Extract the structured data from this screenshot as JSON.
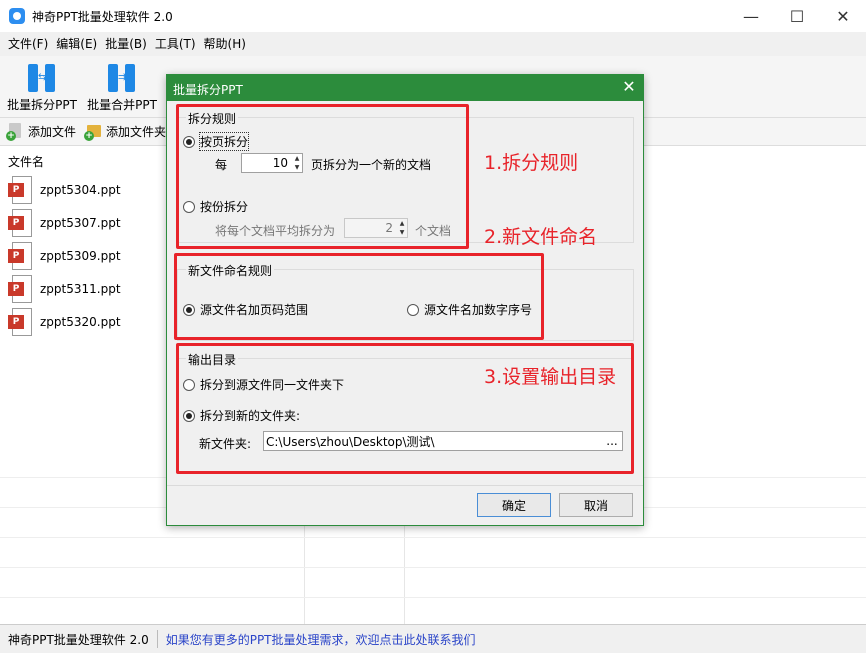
{
  "window": {
    "title": "神奇PPT批量处理软件 2.0",
    "min": "—",
    "max": "☐",
    "close": "✕"
  },
  "menu": [
    "文件(F)",
    "编辑(E)",
    "批量(B)",
    "工具(T)",
    "帮助(H)"
  ],
  "toolbar": {
    "split_label": "批量拆分PPT",
    "merge_label": "批量合并PPT"
  },
  "subtoolbar": {
    "add_file": "添加文件",
    "add_folder": "添加文件夹"
  },
  "file_list": {
    "header": "文件名",
    "files": [
      "zppt5304.ppt",
      "zppt5307.ppt",
      "zppt5309.ppt",
      "zppt5311.ppt",
      "zppt5320.ppt"
    ],
    "badge_text": "P"
  },
  "status": {
    "app": "神奇PPT批量处理软件 2.0",
    "message": "如果您有更多的PPT批量处理需求，欢迎点击此处联系我们"
  },
  "dialog": {
    "title": "批量拆分PPT",
    "close": "✕",
    "split_rule": {
      "legend": "拆分规则",
      "by_page": "按页拆分",
      "every_label": "每",
      "pages_value": "10",
      "pages_suffix": "页拆分为一个新的文档",
      "by_count": "按份拆分",
      "count_prefix": "将每个文档平均拆分为",
      "count_value": "2",
      "count_suffix": "个文档",
      "by_page_selected": true
    },
    "naming": {
      "legend": "新文件命名规则",
      "opt_page_range": "源文件名加页码范围",
      "opt_number": "源文件名加数字序号",
      "page_range_selected": true
    },
    "output": {
      "legend": "输出目录",
      "opt_same_folder": "拆分到源文件同一文件夹下",
      "opt_new_folder": "拆分到新的文件夹:",
      "new_folder_label": "新文件夹:",
      "path": "C:\\Users\\zhou\\Desktop\\测试\\",
      "browse": "...",
      "new_folder_selected": true
    },
    "ok": "确定",
    "cancel": "取消"
  },
  "annotations": {
    "note1": "1.拆分规则",
    "note2": "2.新文件命名",
    "note3": "3.设置输出目录"
  },
  "colors": {
    "dialog_accent": "#2c8c3c",
    "annotation_red": "#e8232a",
    "toolbar_blue": "#1e88e5",
    "status_link": "#2a44c8"
  }
}
